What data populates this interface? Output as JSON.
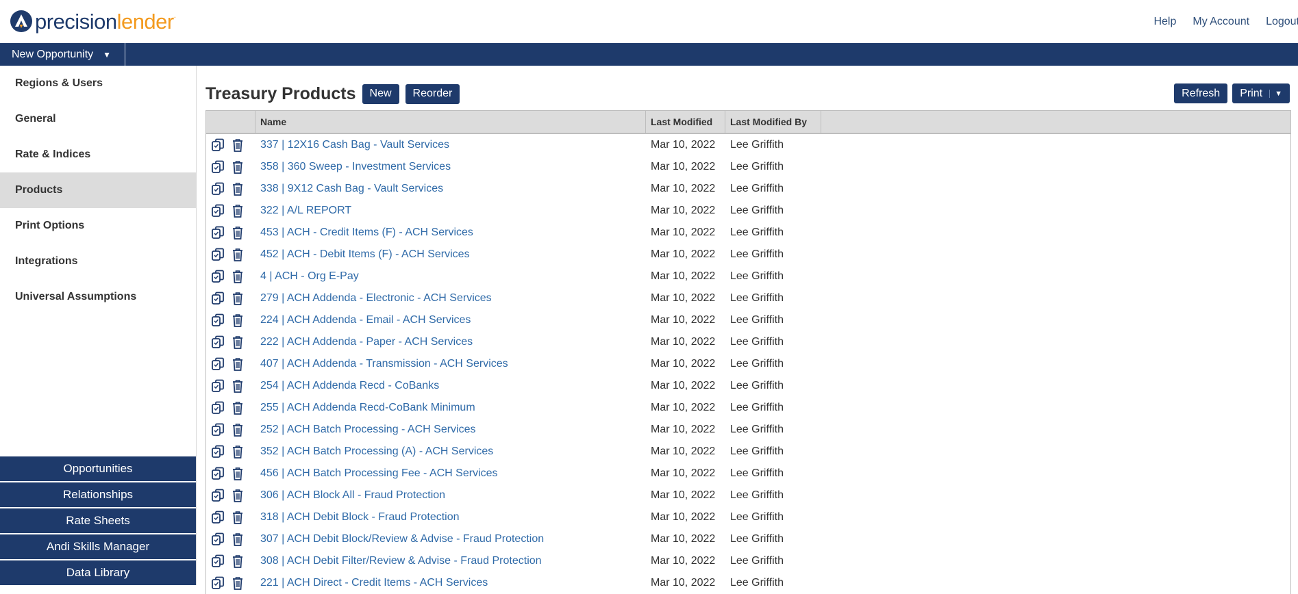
{
  "header": {
    "logo_precision": "precision",
    "logo_lender": "lender",
    "logo_tm": ".",
    "links": [
      "Help",
      "My Account",
      "Logout"
    ]
  },
  "navbar": {
    "new_opportunity": "New Opportunity"
  },
  "sidebar": {
    "items": [
      {
        "label": "Regions & Users"
      },
      {
        "label": "General"
      },
      {
        "label": "Rate & Indices"
      },
      {
        "label": "Products"
      },
      {
        "label": "Print Options"
      },
      {
        "label": "Integrations"
      },
      {
        "label": "Universal Assumptions"
      }
    ],
    "active": "Products",
    "bottom_buttons": [
      "Opportunities",
      "Relationships",
      "Rate Sheets",
      "Andi Skills Manager",
      "Data Library"
    ]
  },
  "main": {
    "title": "Treasury Products",
    "new_label": "New",
    "reorder_label": "Reorder",
    "refresh_label": "Refresh",
    "print_label": "Print",
    "columns": [
      "Name",
      "Last Modified",
      "Last Modified By"
    ],
    "rows": [
      {
        "name": "337 | 12X16 Cash Bag - Vault Services",
        "modified": "Mar 10, 2022",
        "by": "Lee Griffith"
      },
      {
        "name": "358 | 360 Sweep - Investment Services",
        "modified": "Mar 10, 2022",
        "by": "Lee Griffith"
      },
      {
        "name": "338 | 9X12 Cash Bag - Vault Services",
        "modified": "Mar 10, 2022",
        "by": "Lee Griffith"
      },
      {
        "name": "322 | A/L REPORT",
        "modified": "Mar 10, 2022",
        "by": "Lee Griffith"
      },
      {
        "name": "453 | ACH - Credit Items (F) - ACH Services",
        "modified": "Mar 10, 2022",
        "by": "Lee Griffith"
      },
      {
        "name": "452 | ACH - Debit Items (F) - ACH Services",
        "modified": "Mar 10, 2022",
        "by": "Lee Griffith"
      },
      {
        "name": "4 | ACH - Org E-Pay",
        "modified": "Mar 10, 2022",
        "by": "Lee Griffith"
      },
      {
        "name": "279 | ACH Addenda - Electronic - ACH Services",
        "modified": "Mar 10, 2022",
        "by": "Lee Griffith"
      },
      {
        "name": "224 | ACH Addenda - Email - ACH Services",
        "modified": "Mar 10, 2022",
        "by": "Lee Griffith"
      },
      {
        "name": "222 | ACH Addenda - Paper - ACH Services",
        "modified": "Mar 10, 2022",
        "by": "Lee Griffith"
      },
      {
        "name": "407 | ACH Addenda - Transmission - ACH Services",
        "modified": "Mar 10, 2022",
        "by": "Lee Griffith"
      },
      {
        "name": "254 | ACH Addenda Recd - CoBanks",
        "modified": "Mar 10, 2022",
        "by": "Lee Griffith"
      },
      {
        "name": "255 | ACH Addenda Recd-CoBank Minimum",
        "modified": "Mar 10, 2022",
        "by": "Lee Griffith"
      },
      {
        "name": "252 | ACH Batch Processing - ACH Services",
        "modified": "Mar 10, 2022",
        "by": "Lee Griffith"
      },
      {
        "name": "352 | ACH Batch Processing (A) - ACH Services",
        "modified": "Mar 10, 2022",
        "by": "Lee Griffith"
      },
      {
        "name": "456 | ACH Batch Processing Fee - ACH Services",
        "modified": "Mar 10, 2022",
        "by": "Lee Griffith"
      },
      {
        "name": "306 | ACH Block All - Fraud Protection",
        "modified": "Mar 10, 2022",
        "by": "Lee Griffith"
      },
      {
        "name": "318 | ACH Debit Block - Fraud Protection",
        "modified": "Mar 10, 2022",
        "by": "Lee Griffith"
      },
      {
        "name": "307 | ACH Debit Block/Review & Advise - Fraud Protection",
        "modified": "Mar 10, 2022",
        "by": "Lee Griffith"
      },
      {
        "name": "308 | ACH Debit Filter/Review & Advise - Fraud Protection",
        "modified": "Mar 10, 2022",
        "by": "Lee Griffith"
      },
      {
        "name": "221 | ACH Direct - Credit Items - ACH Services",
        "modified": "Mar 10, 2022",
        "by": "Lee Griffith"
      }
    ]
  },
  "icons": {
    "copy": "copy-icon",
    "delete": "trash-icon",
    "logo": "precision-logo-icon"
  },
  "colors": {
    "navy": "#1e3a6b",
    "orange": "#f39a1e",
    "link": "#2f6aa8"
  }
}
